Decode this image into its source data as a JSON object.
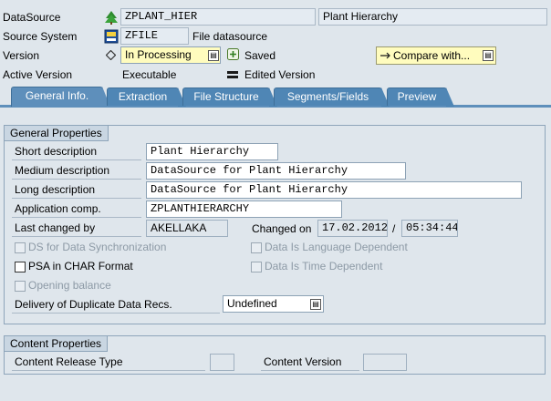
{
  "header": {
    "datasource_label": "DataSource",
    "datasource_value": "ZPLANT_HIER",
    "datasource_desc": "Plant Hierarchy",
    "source_system_label": "Source System",
    "source_system_value": "ZFILE",
    "source_system_desc": "File datasource",
    "version_label": "Version",
    "version_value": "In Processing",
    "version_status": "Saved",
    "active_version_label": "Active Version",
    "active_version_value": "Executable",
    "edited_version_label": "Edited Version",
    "compare_button": "Compare with...",
    "version_marker_icon": "diamond-icon",
    "equal_marker_icon": "equals-icon"
  },
  "tabs": [
    {
      "label": "General Info.",
      "active": true
    },
    {
      "label": "Extraction",
      "active": false
    },
    {
      "label": "File Structure",
      "active": false
    },
    {
      "label": "Segments/Fields",
      "active": false
    },
    {
      "label": "Preview",
      "active": false
    }
  ],
  "general": {
    "title": "General Properties",
    "short_label": "Short description",
    "short_value": "Plant Hierarchy",
    "medium_label": "Medium description",
    "medium_value": "DataSource for Plant Hierarchy",
    "long_label": "Long description",
    "long_value": "DataSource for Plant Hierarchy",
    "appcomp_label": "Application comp.",
    "appcomp_value": "ZPLANTHIERARCHY",
    "changed_by_label": "Last changed by",
    "changed_by_value": "AKELLAKA",
    "changed_on_label": "Changed on",
    "changed_on_date": "17.02.2012",
    "date_sep": "/",
    "changed_on_time": "05:34:44",
    "ds_sync": "DS for Data Synchronization",
    "lang_dep": "Data Is Language Dependent",
    "psa_char": "PSA in CHAR Format",
    "time_dep": "Data Is Time Dependent",
    "opening_balance": "Opening balance",
    "delivery_label": "Delivery of Duplicate Data Recs.",
    "delivery_value": "Undefined"
  },
  "content": {
    "title": "Content Properties",
    "release_label": "Content Release Type",
    "release_value": "",
    "version_label": "Content Version",
    "version_value": ""
  }
}
